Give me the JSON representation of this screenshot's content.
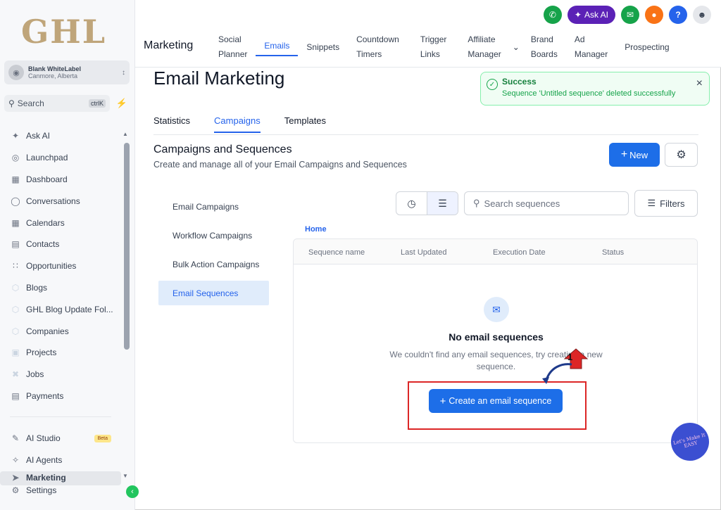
{
  "sidebar": {
    "logo": "GHL",
    "location": {
      "name": "Blank WhiteLabel",
      "city": "Canmore, Alberta"
    },
    "search": {
      "label": "Search",
      "shortcut": "ctrlK"
    },
    "items": [
      {
        "label": "Ask AI",
        "icon": "sparkle-icon"
      },
      {
        "label": "Launchpad",
        "icon": "rocket-icon"
      },
      {
        "label": "Dashboard",
        "icon": "grid-icon"
      },
      {
        "label": "Conversations",
        "icon": "chat-icon"
      },
      {
        "label": "Calendars",
        "icon": "calendar-icon"
      },
      {
        "label": "Contacts",
        "icon": "contacts-icon"
      },
      {
        "label": "Opportunities",
        "icon": "funnel-icon"
      },
      {
        "label": "Blogs",
        "icon": "cube-icon"
      },
      {
        "label": "GHL Blog Update Fol...",
        "icon": "cube-icon"
      },
      {
        "label": "Companies",
        "icon": "cube-icon"
      },
      {
        "label": "Projects",
        "icon": "cube-icon"
      },
      {
        "label": "Jobs",
        "icon": "tools-icon"
      },
      {
        "label": "Payments",
        "icon": "receipt-icon"
      }
    ],
    "lower_items": [
      {
        "label": "AI Studio",
        "badge": "Beta"
      },
      {
        "label": "AI Agents"
      },
      {
        "label": "Marketing"
      },
      {
        "label": "Settings"
      }
    ]
  },
  "topbar": {
    "section_title": "Marketing",
    "ask_ai": "Ask AI",
    "help": "?",
    "tabs": [
      {
        "line1": "Social",
        "line2": "Planner"
      },
      {
        "line1": "Emails",
        "line2": ""
      },
      {
        "line1": "Snippets",
        "line2": ""
      },
      {
        "line1": "Countdown",
        "line2": "Timers"
      },
      {
        "line1": "Trigger",
        "line2": "Links"
      },
      {
        "line1": "Affiliate",
        "line2": "Manager"
      },
      {
        "line1": "Brand",
        "line2": "Boards"
      },
      {
        "line1": "Ad",
        "line2": "Manager"
      },
      {
        "line1": "Prospecting",
        "line2": ""
      }
    ]
  },
  "main": {
    "title": "Email Marketing",
    "toast": {
      "title": "Success",
      "message": "Sequence 'Untitled sequence' deleted successfully"
    },
    "subtabs": [
      "Statistics",
      "Campaigns",
      "Templates"
    ],
    "section_title": "Campaigns and Sequences",
    "section_subtitle": "Create and manage all of your Email Campaigns and Sequences",
    "new_button": "New",
    "left_menu": [
      "Email Campaigns",
      "Workflow Campaigns",
      "Bulk Action Campaigns",
      "Email Sequences"
    ],
    "search_placeholder": "Search sequences",
    "filters": "Filters",
    "breadcrumb": "Home",
    "columns": [
      "Sequence name",
      "Last Updated",
      "Execution Date",
      "Status"
    ],
    "empty_title": "No email sequences",
    "empty_message": "We couldn't find any email sequences, try creating a new sequence.",
    "create_button": "Create an email sequence"
  },
  "annotation": {
    "step": "1",
    "badge": "Let's Make It EASY"
  },
  "colors": {
    "primary": "#1d6ee8",
    "success": "#16a34a",
    "annotation": "#dc2626"
  }
}
